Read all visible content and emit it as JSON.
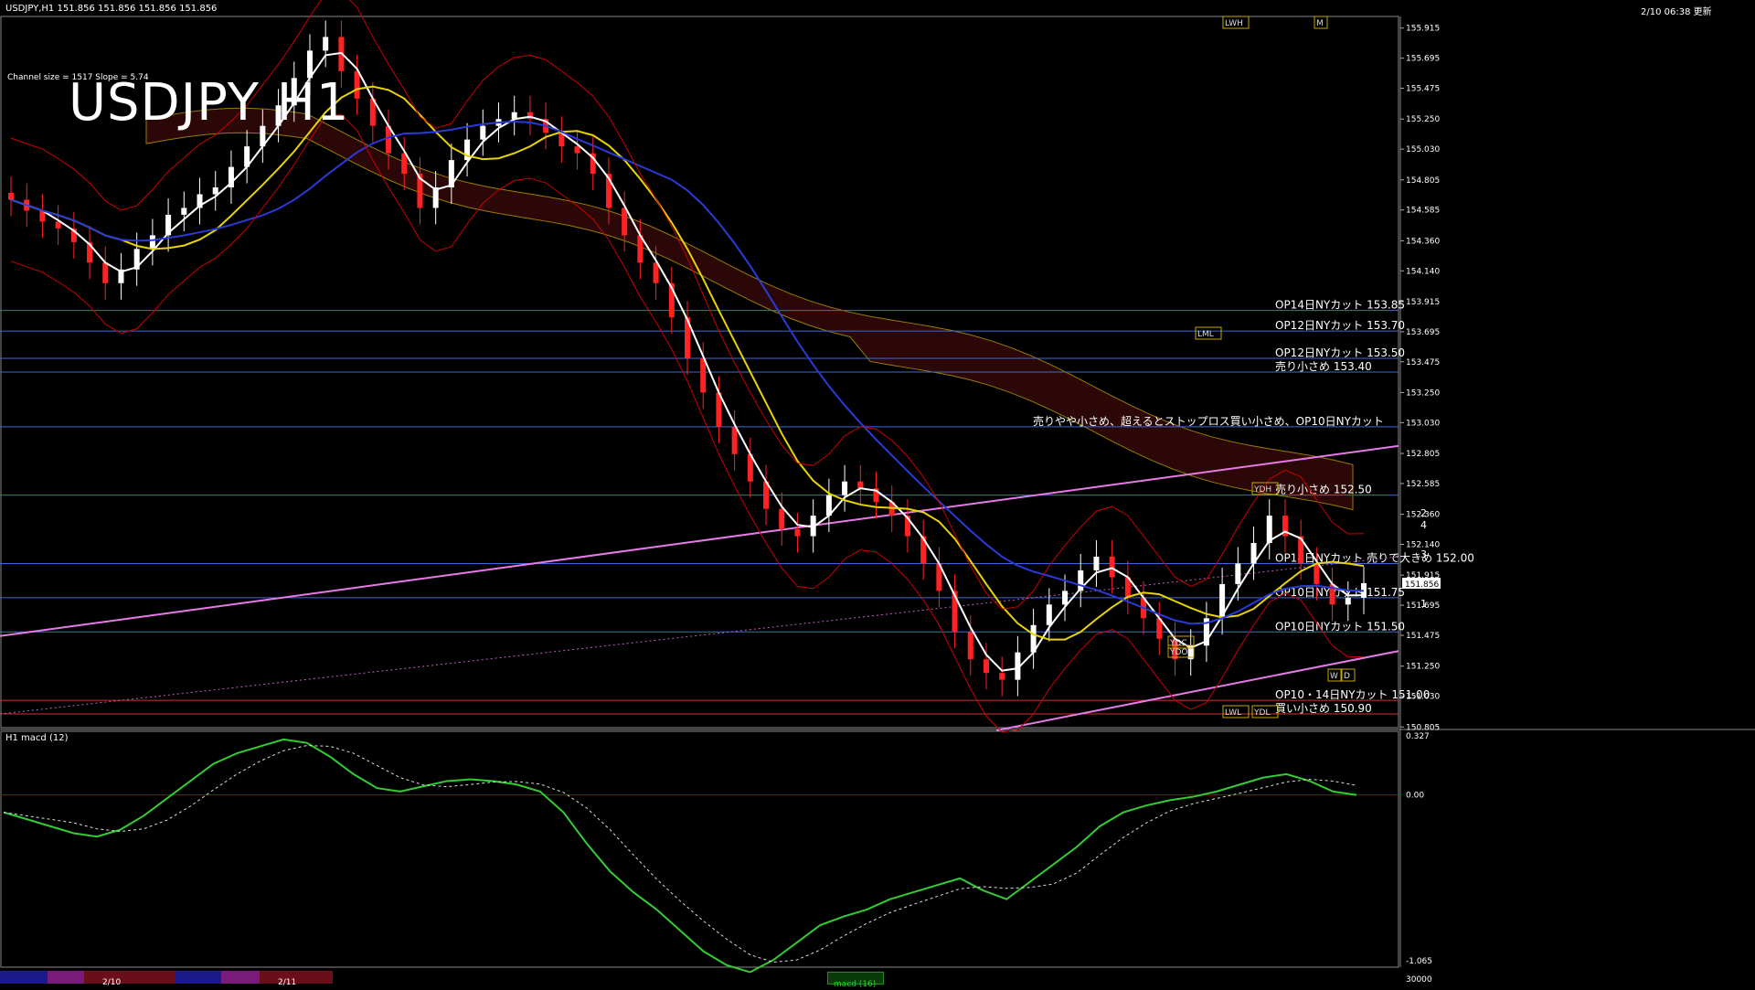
{
  "header": {
    "symbol_info": "USDJPY,H1  151.856 151.856 151.856 151.856",
    "datetime": "2/10 06:38 更新",
    "channel_info": "Channel size = 1517 Slope = 5.74",
    "big_symbol": "USDJPY H1"
  },
  "macd_panel": {
    "title": "H1  macd (12)",
    "scale_top": "0.327",
    "scale_zero": "0.00",
    "scale_bottom": "-1.065",
    "footer_right": "30000"
  },
  "bottom_tabs": {
    "date1": "2/10",
    "date2": "2/11",
    "active": "macd (16)"
  },
  "current_price": "151.856",
  "price_axis": {
    "labels": [
      "155.915",
      "155.695",
      "155.475",
      "155.250",
      "155.030",
      "154.805",
      "154.585",
      "154.360",
      "154.140",
      "153.915",
      "153.695",
      "153.475",
      "153.250",
      "153.030",
      "152.805",
      "152.585",
      "152.360",
      "152.140",
      "151.915",
      "151.695",
      "151.475",
      "151.250",
      "151.030",
      "150.805"
    ]
  },
  "annotations": [
    {
      "text": "OP14日NYカット 153.85",
      "price": 153.85
    },
    {
      "text": "OP12日NYカット 153.70",
      "price": 153.7
    },
    {
      "text": "OP12日NYカット 153.50",
      "price": 153.5
    },
    {
      "text": "売り小さめ 153.40",
      "price": 153.4
    },
    {
      "text": "売りやや小さめ、超えるとストップロス買い小さめ、OP10日NYカット",
      "price": 153.0
    },
    {
      "text": "売り小さめ 152.50",
      "price": 152.5
    },
    {
      "text": "OP14日NYカット 売りで大きめ 152.00",
      "price": 152.0
    },
    {
      "text": "OP10日NYカット 151.75",
      "price": 151.75
    },
    {
      "text": "OP10日NYカット 151.50",
      "price": 151.5
    },
    {
      "text": "OP10・14日NYカット 151.00",
      "price": 151.0
    },
    {
      "text": "買い小さめ 150.90",
      "price": 150.9
    }
  ],
  "box_labels": [
    "LWH",
    "M",
    "LML",
    "YDH",
    "YDC",
    "YDO",
    "W",
    "D",
    "LWL",
    "YDL"
  ],
  "wave_labels": [
    "2",
    "4",
    "3",
    "1"
  ],
  "chart_data": {
    "type": "candlestick",
    "title": "USDJPY H1",
    "ylim": [
      150.8,
      156.0
    ],
    "series": [
      {
        "name": "close",
        "values": [
          154.66,
          154.58,
          154.5,
          154.45,
          154.35,
          154.2,
          154.05,
          154.15,
          154.3,
          154.4,
          154.55,
          154.6,
          154.7,
          154.75,
          154.9,
          155.05,
          155.2,
          155.35,
          155.55,
          155.75,
          155.85,
          155.6,
          155.4,
          155.2,
          155.0,
          154.85,
          154.6,
          154.75,
          154.95,
          155.1,
          155.2,
          155.25,
          155.3,
          155.25,
          155.15,
          155.05,
          155.0,
          154.85,
          154.6,
          154.4,
          154.2,
          154.05,
          153.8,
          153.5,
          153.25,
          153.0,
          152.8,
          152.6,
          152.4,
          152.25,
          152.2,
          152.35,
          152.5,
          152.6,
          152.55,
          152.45,
          152.35,
          152.2,
          152.0,
          151.8,
          151.5,
          151.3,
          151.2,
          151.15,
          151.35,
          151.55,
          151.7,
          151.8,
          151.95,
          152.05,
          151.9,
          151.75,
          151.6,
          151.45,
          151.3,
          151.4,
          151.6,
          151.85,
          152.0,
          152.15,
          152.35,
          152.2,
          152.0,
          151.85,
          151.7,
          151.75,
          151.856
        ]
      }
    ],
    "macd_main": [
      -0.1,
      -0.14,
      -0.18,
      -0.22,
      -0.24,
      -0.2,
      -0.12,
      -0.02,
      0.08,
      0.18,
      0.24,
      0.28,
      0.32,
      0.3,
      0.22,
      0.12,
      0.04,
      0.02,
      0.05,
      0.08,
      0.09,
      0.08,
      0.06,
      0.02,
      -0.1,
      -0.28,
      -0.44,
      -0.56,
      -0.66,
      -0.78,
      -0.9,
      -0.98,
      -1.02,
      -0.95,
      -0.85,
      -0.75,
      -0.7,
      -0.66,
      -0.6,
      -0.56,
      -0.52,
      -0.48,
      -0.55,
      -0.6,
      -0.5,
      -0.4,
      -0.3,
      -0.18,
      -0.1,
      -0.06,
      -0.03,
      -0.01,
      0.02,
      0.06,
      0.1,
      0.12,
      0.08,
      0.02,
      0.0
    ]
  }
}
